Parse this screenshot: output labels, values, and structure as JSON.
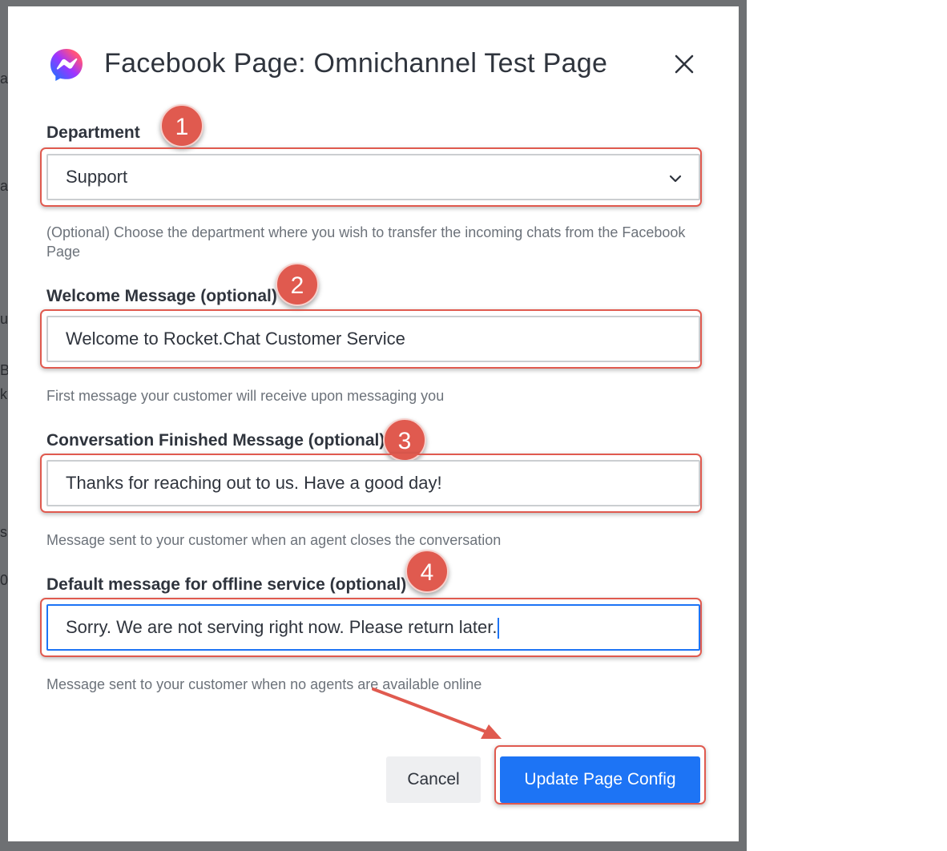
{
  "dialog": {
    "title": "Facebook Page: Omnichannel Test Page"
  },
  "fields": {
    "department": {
      "label": "Department",
      "value": "Support",
      "hint": "(Optional) Choose the department where you wish to transfer the incoming chats from the Facebook Page"
    },
    "welcome": {
      "label": "Welcome Message (optional)",
      "value": "Welcome to Rocket.Chat Customer Service",
      "hint": "First message your customer will receive upon messaging you"
    },
    "finished": {
      "label": "Conversation Finished Message (optional)",
      "value": "Thanks for reaching out to us. Have a good day!",
      "hint": "Message sent to your customer when an agent closes the conversation"
    },
    "offline": {
      "label": "Default message for offline service (optional)",
      "value": "Sorry. We are not serving right now. Please return later.",
      "hint": "Message sent to your customer when no agents are available online"
    }
  },
  "buttons": {
    "cancel": "Cancel",
    "update": "Update Page Config"
  },
  "annotations": {
    "badges": [
      "1",
      "2",
      "3",
      "4"
    ]
  },
  "icons": {
    "app": "messenger-icon",
    "close": "close-icon",
    "dropdown": "chevron-down-icon"
  },
  "colors": {
    "primary": "#1d74f5",
    "annotation": "#e05a4f",
    "backdrop": "#6e7073"
  }
}
